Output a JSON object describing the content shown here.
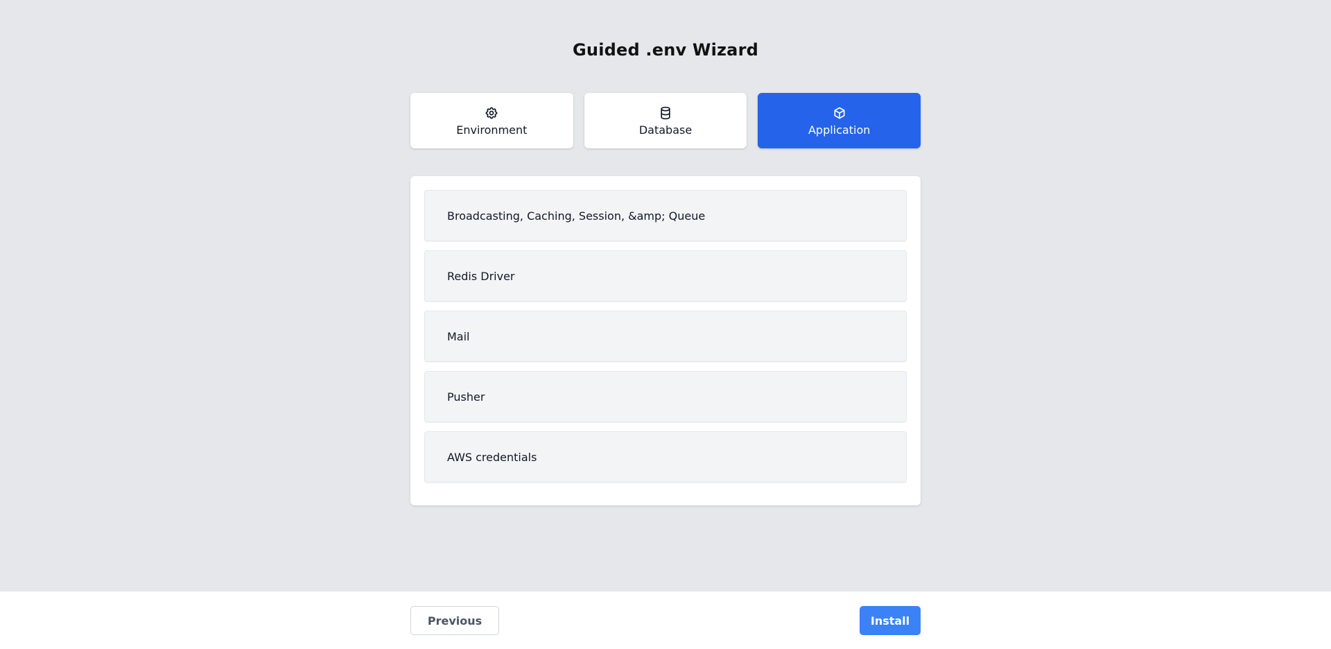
{
  "title": "Guided  .env Wizard",
  "tabs": [
    {
      "label": "Environment",
      "icon": "gear-icon",
      "active": false
    },
    {
      "label": "Database",
      "icon": "database-icon",
      "active": false
    },
    {
      "label": "Application",
      "icon": "cube-icon",
      "active": true
    }
  ],
  "sections": [
    {
      "label": "Broadcasting, Caching, Session, &amp; Queue"
    },
    {
      "label": "Redis Driver"
    },
    {
      "label": "Mail"
    },
    {
      "label": "Pusher"
    },
    {
      "label": "AWS credentials"
    }
  ],
  "footer": {
    "previous_label": "Previous",
    "install_label": "Install"
  },
  "colors": {
    "accent": "#2563eb",
    "install_button": "#3b82f6",
    "background": "#e5e7eb"
  }
}
